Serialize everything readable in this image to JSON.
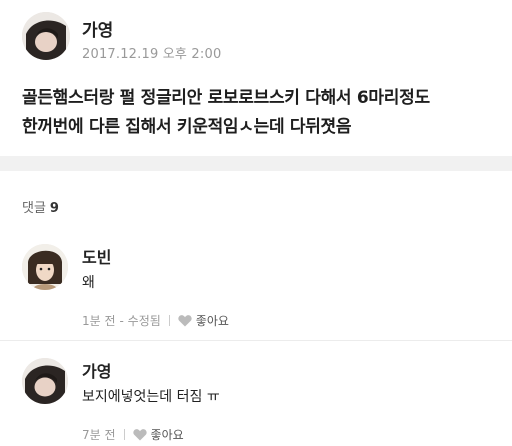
{
  "post": {
    "author": "가영",
    "timestamp": "2017.12.19 오후 2:00",
    "body_line1": "골든햄스터랑 펄 정글리안 로보로브스키 다해서 6마리정도",
    "body_line2": "한꺼번에 다른 집해서 키운적임ㅅ는데 다뒤졋음"
  },
  "comments_header": {
    "label": "댓글",
    "count": "9"
  },
  "comments": [
    {
      "author": "도빈",
      "text": "왜",
      "time": "1분 전",
      "edited": "- 수정됨",
      "like_label": "좋아요"
    },
    {
      "author": "가영",
      "text": "보지에넣엇는데 터짐 ㅠ",
      "time": "7분 전",
      "edited": "",
      "like_label": "좋아요"
    }
  ],
  "colors": {
    "divider": "#f1f1f1",
    "meta_text": "#999999",
    "heart": "#bbbbbb"
  }
}
